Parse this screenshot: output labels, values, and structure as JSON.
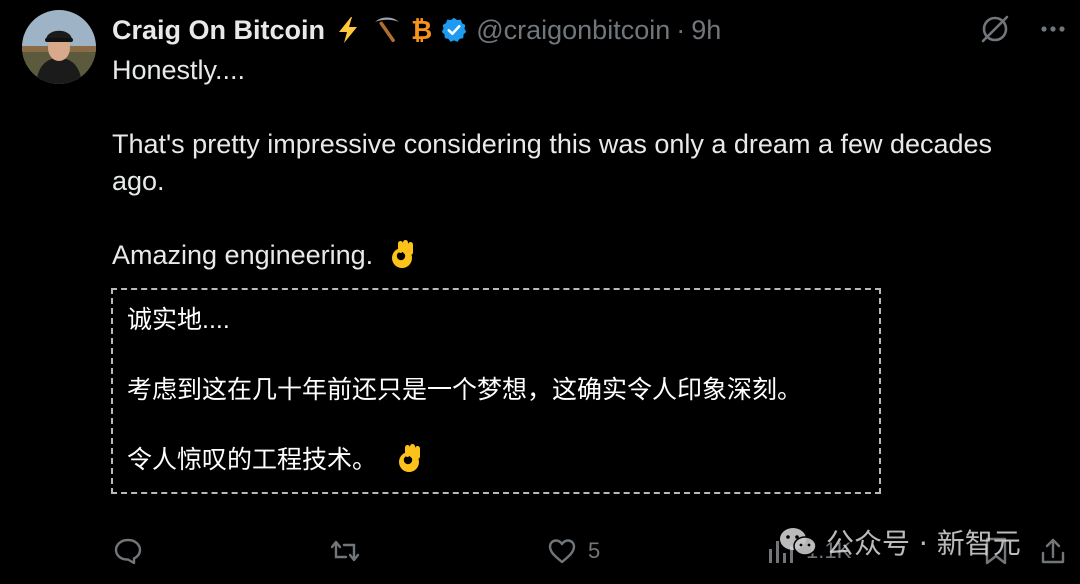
{
  "tweet": {
    "display_name": "Craig On Bitcoin",
    "name_emojis": [
      "lightning-emoji",
      "pickaxe-emoji",
      "bitcoin-symbol"
    ],
    "bitcoin_glyph": "₿",
    "handle": "@craigonbitcoin",
    "separator": "·",
    "time": "9h",
    "text": {
      "line1": "Honestly....",
      "line2": "That's pretty impressive considering this was only a dream a few decades ago.",
      "line3": "Amazing engineering."
    }
  },
  "translation": {
    "line1": "诚实地....",
    "line2": "考虑到这在几十年前还只是一个梦想，这确实令人印象深刻。",
    "line3": "令人惊叹的工程技术。"
  },
  "actions": {
    "reply_count": "",
    "retweet_count": "",
    "like_count": "5",
    "views_count": "1.1K"
  },
  "watermark": {
    "text": "公众号 · 新智元"
  },
  "colors": {
    "background": "#000000",
    "text": "#e7e9ea",
    "muted": "#71767b",
    "verified": "#1d9bf0",
    "bitcoin": "#f7931a"
  }
}
